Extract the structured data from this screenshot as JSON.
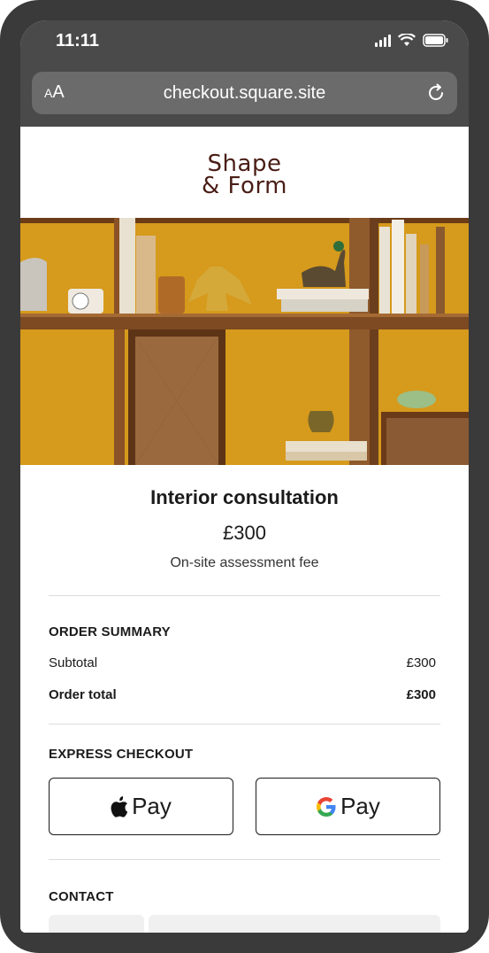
{
  "status_bar": {
    "time": "11:11"
  },
  "browser": {
    "text_size_label": "AA",
    "url": "checkout.square.site"
  },
  "store": {
    "logo_line1": "Shape",
    "logo_line2": "& Form"
  },
  "product": {
    "title": "Interior consultation",
    "price": "£300",
    "description": "On-site assessment fee"
  },
  "order_summary": {
    "heading": "ORDER SUMMARY",
    "subtotal_label": "Subtotal",
    "subtotal_value": "£300",
    "total_label": "Order total",
    "total_value": "£300"
  },
  "express_checkout": {
    "heading": "EXPRESS CHECKOUT",
    "apple_pay_label": "Pay",
    "google_pay_label": "Pay"
  },
  "contact": {
    "heading": "CONTACT"
  },
  "icons": {
    "signal": "cellular-signal-icon",
    "wifi": "wifi-icon",
    "battery": "battery-icon",
    "reload": "reload-icon",
    "apple": "apple-logo-icon",
    "google": "google-g-logo-icon"
  }
}
